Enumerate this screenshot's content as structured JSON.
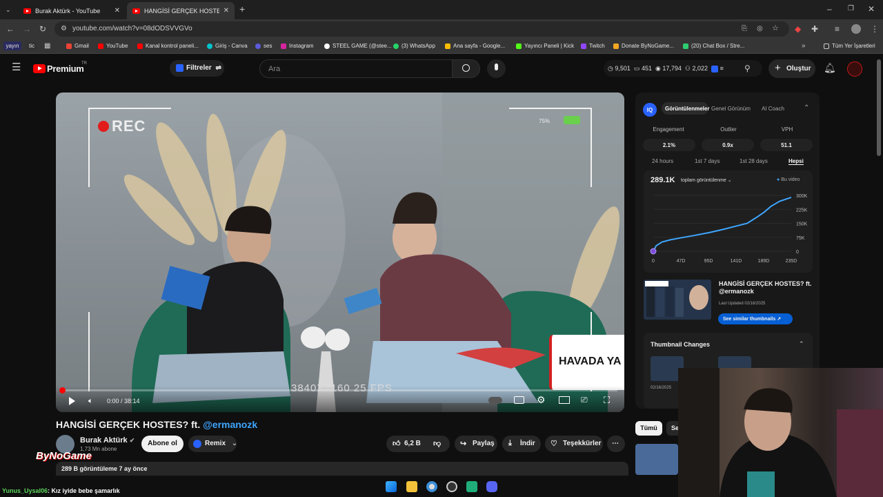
{
  "browser": {
    "tabs": [
      {
        "title": "Burak Aktürk - YouTube",
        "active": false
      },
      {
        "title": "HANGİSİ GERÇEK HOSTES? ft. @",
        "active": true
      }
    ],
    "url": "youtube.com/watch?v=08dODSVVGVo",
    "bookmarks": [
      "Gmail",
      "YouTube",
      "Kanal kontrol paneli...",
      "Giriş - Canva",
      "ses",
      "Instagram",
      "STEEL GAME (@stee...",
      "(3) WhatsApp",
      "Ana sayfa - Google...",
      "Yayıncı Paneli | Kick",
      "Twitch",
      "Donate ByNoGame...",
      "(20) Chat Box / Stre..."
    ],
    "bookmark_left_chips": [
      "yayın",
      "tic"
    ],
    "all_bookmarks": "Tüm Yer İşaretleri"
  },
  "youtube": {
    "logo": "Premium",
    "logo_region": "TR",
    "filters_label": "Filtreler",
    "search_placeholder": "Ara",
    "stats": {
      "views": "9,501",
      "s2": "451",
      "s3": "17,794",
      "s4": "2,022"
    },
    "create_label": "Oluştur"
  },
  "video": {
    "rec_label": "REC",
    "battery": "75%",
    "resolution": "3840X2160 25 FPS",
    "banner": "HAVADA YA",
    "time": "0:00 / 38:14",
    "progress": 0.0
  },
  "details": {
    "title_main": "HANGİSİ GERÇEK HOSTES? ft.",
    "title_handle": "@ermanozk",
    "channel": "Burak Aktürk",
    "subscribers": "1,73 Mn abone",
    "subscribe_label": "Abone ol",
    "remix_label": "Remix",
    "likes": "6,2 B",
    "share_label": "Paylaş",
    "download_label": "İndir",
    "thanks_label": "Teşekkürler",
    "views_line": "289 B görüntüleme  7 ay önce",
    "overlay_logo": "ByNoGame"
  },
  "panel": {
    "tabs": [
      "Görüntülenmeler",
      "Genel Görünüm",
      "AI Coach"
    ],
    "metrics": [
      {
        "label": "Engagement",
        "value": "2.1%"
      },
      {
        "label": "Outlier",
        "value": "0.9x"
      },
      {
        "label": "VPH",
        "value": "51.1"
      }
    ],
    "ranges": [
      "24 hours",
      "1st 7 days",
      "1st 28 days",
      "Hepsi"
    ],
    "total": "289.1K",
    "total_label": "toplam görüntülenme",
    "legend": "Bu video",
    "similar": {
      "title": "HANGİSİ GERÇEK HOSTES? ft. @ermanozk",
      "updated": "Last Updated 02/16/2025",
      "button": "See similar thumbnails"
    },
    "thumb_changes": "Thumbnail Changes",
    "thumb_date": "02/16/2025"
  },
  "chart_data": {
    "type": "line",
    "x_ticks": [
      "0",
      "47D",
      "95D",
      "141D",
      "189D",
      "235D"
    ],
    "y_ticks": [
      "300K",
      "225K",
      "150K",
      "75K",
      "0"
    ],
    "ylim": [
      0,
      300000
    ],
    "xlim": [
      0,
      235
    ],
    "series": [
      {
        "name": "Bu video",
        "x": [
          0,
          5,
          15,
          30,
          47,
          70,
          95,
          120,
          141,
          160,
          175,
          189,
          200,
          215,
          235
        ],
        "y": [
          0,
          30000,
          50000,
          62000,
          72000,
          85000,
          100000,
          118000,
          135000,
          150000,
          180000,
          210000,
          240000,
          268000,
          289100
        ]
      }
    ]
  },
  "below": {
    "chip_all": "Tümü",
    "chip_more": "Se"
  },
  "chat": {
    "user": "Yunus_Uysal06",
    "message": ": Kız iyide bebe şamarlık"
  },
  "colors": {
    "accent": "#3ea6ff",
    "brand": "#ff0000",
    "chart_line": "#3ea6ff"
  }
}
